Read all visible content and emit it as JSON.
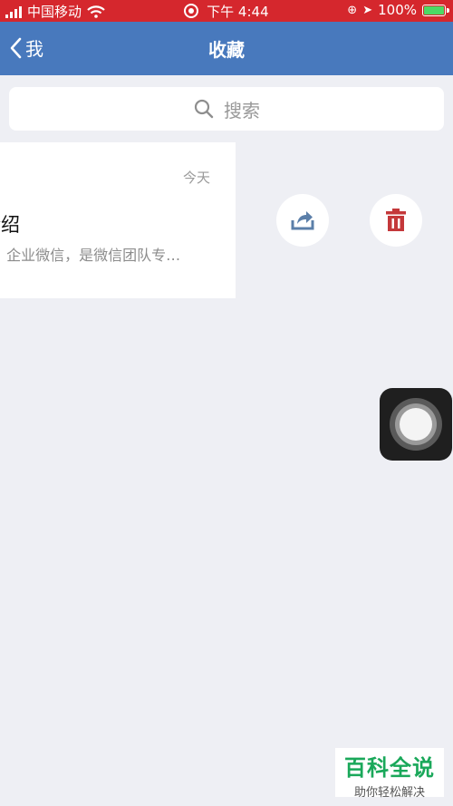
{
  "status": {
    "carrier": "中国移动",
    "time": "下午 4:44",
    "battery": "100%"
  },
  "nav": {
    "back_label": "我",
    "title": "收藏"
  },
  "search": {
    "placeholder": "搜索"
  },
  "favorite": {
    "date": "今天",
    "title": "介绍",
    "description": "召 企业微信，是微信团队专…"
  },
  "actions": {
    "share_color": "#5b7fa9",
    "delete_color": "#c4383a"
  },
  "watermark": {
    "line1": "百科全说",
    "line2": "助你轻松解决"
  }
}
